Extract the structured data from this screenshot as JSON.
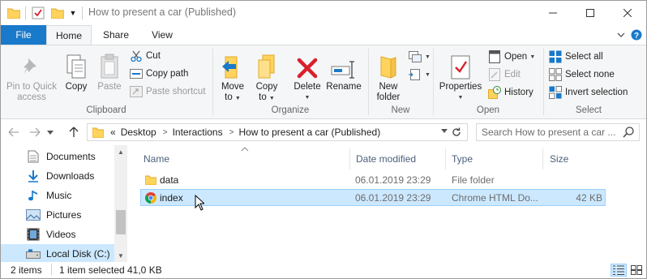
{
  "window": {
    "title": "How to present a car (Published)",
    "controls": {
      "minimize": "—",
      "maximize": "☐",
      "close": "✕"
    }
  },
  "tabs": {
    "file": "File",
    "home": "Home",
    "share": "Share",
    "view": "View"
  },
  "ribbon": {
    "clipboard": {
      "pin_line1": "Pin to Quick",
      "pin_line2": "access",
      "copy": "Copy",
      "paste": "Paste",
      "cut": "Cut",
      "copy_path": "Copy path",
      "paste_shortcut": "Paste shortcut",
      "label": "Clipboard"
    },
    "organize": {
      "move_line1": "Move",
      "move_line2": "to",
      "copy_line1": "Copy",
      "copy_line2": "to",
      "delete": "Delete",
      "rename": "Rename",
      "label": "Organize"
    },
    "new": {
      "new_folder_line1": "New",
      "new_folder_line2": "folder",
      "label": "New"
    },
    "open": {
      "properties": "Properties",
      "open": "Open",
      "edit": "Edit",
      "history": "History",
      "label": "Open"
    },
    "select": {
      "select_all": "Select all",
      "select_none": "Select none",
      "invert": "Invert selection",
      "label": "Select"
    }
  },
  "address": {
    "overflow": "«",
    "crumbs": [
      "Desktop",
      "Interactions",
      "How to present a car (Published)"
    ],
    "search_placeholder": "Search How to present a car ..."
  },
  "navpane": {
    "items": [
      {
        "label": "Documents",
        "icon": "documents-icon"
      },
      {
        "label": "Downloads",
        "icon": "downloads-icon"
      },
      {
        "label": "Music",
        "icon": "music-icon"
      },
      {
        "label": "Pictures",
        "icon": "pictures-icon"
      },
      {
        "label": "Videos",
        "icon": "videos-icon"
      },
      {
        "label": "Local Disk (C:)",
        "icon": "drive-icon",
        "selected": true
      }
    ]
  },
  "columns": {
    "name": "Name",
    "date": "Date modified",
    "type": "Type",
    "size": "Size"
  },
  "files": [
    {
      "name": "data",
      "date": "06.01.2019 23:29",
      "type": "File folder",
      "size": "",
      "icon": "folder-icon",
      "selected": false
    },
    {
      "name": "index",
      "date": "06.01.2019 23:29",
      "type": "Chrome HTML Do...",
      "size": "42 KB",
      "icon": "chrome-icon",
      "selected": true
    }
  ],
  "status": {
    "count": "2 items",
    "selected": "1 item selected",
    "size": "41,0 KB"
  },
  "colors": {
    "accent": "#1979ca",
    "selection": "#cce8ff",
    "selection_border": "#99d1ff",
    "folder": "#ffd35c",
    "delete_red": "#d9202c"
  }
}
